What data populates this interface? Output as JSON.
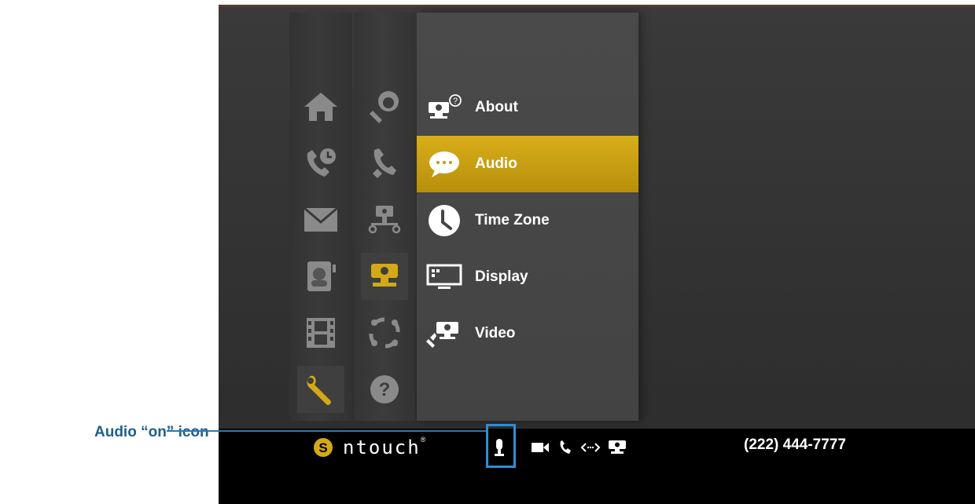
{
  "main_nav": {
    "items": [
      {
        "icon": "home-icon",
        "selected": false
      },
      {
        "icon": "call-history-icon",
        "selected": false
      },
      {
        "icon": "messages-icon",
        "selected": false
      },
      {
        "icon": "contacts-icon",
        "selected": false
      },
      {
        "icon": "videos-icon",
        "selected": false
      },
      {
        "icon": "settings-icon",
        "selected": true
      }
    ]
  },
  "settings_nav": {
    "items": [
      {
        "icon": "personal-settings-icon",
        "selected": false
      },
      {
        "icon": "call-settings-icon",
        "selected": false
      },
      {
        "icon": "network-settings-icon",
        "selected": false
      },
      {
        "icon": "device-settings-icon",
        "selected": true
      },
      {
        "icon": "sync-settings-icon",
        "selected": false
      },
      {
        "icon": "help-icon",
        "selected": false
      }
    ]
  },
  "submenu": {
    "items": [
      {
        "label": "About",
        "icon": "about-icon",
        "active": false
      },
      {
        "label": "Audio",
        "icon": "audio-icon",
        "active": true
      },
      {
        "label": "Time Zone",
        "icon": "clock-icon",
        "active": false
      },
      {
        "label": "Display",
        "icon": "display-icon",
        "active": false
      },
      {
        "label": "Video",
        "icon": "video-settings-icon",
        "active": false
      }
    ]
  },
  "status_bar": {
    "logo_text": "ntouch",
    "logo_mark": "®",
    "phone_number": "(222) 444-7777",
    "icons": [
      "audio-on-icon",
      "video-camera-icon",
      "phone-icon",
      "network-arrows-icon",
      "videophone-icon"
    ]
  },
  "callout": {
    "label": "Audio “on” icon"
  },
  "colors": {
    "accent": "#d4a817",
    "callout": "#1f5f8c"
  }
}
